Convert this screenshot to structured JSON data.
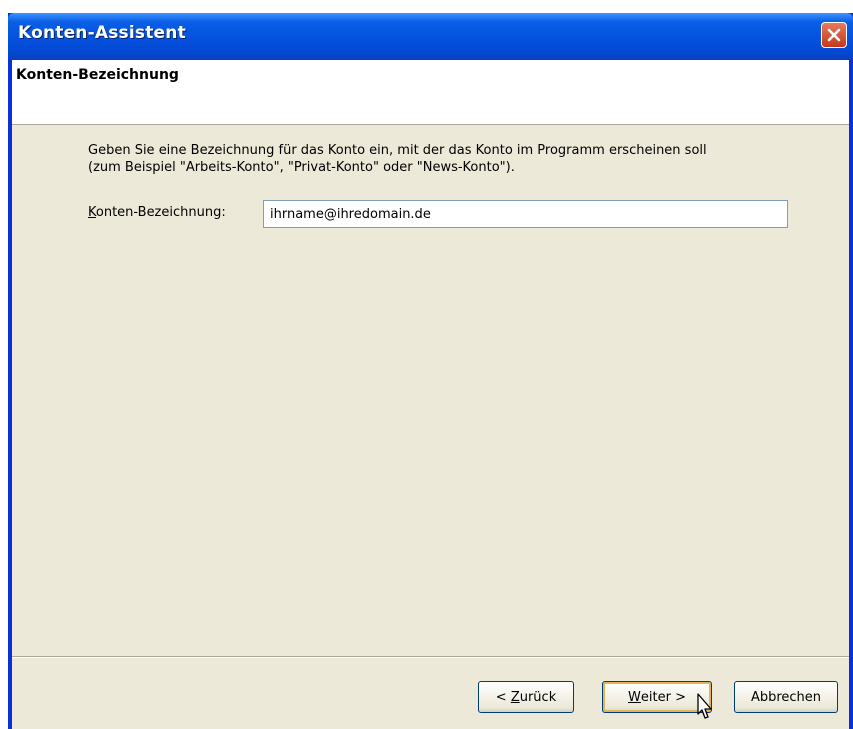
{
  "window": {
    "title": "Konten-Assistent"
  },
  "header": {
    "title": "Konten-Bezeichnung"
  },
  "main": {
    "instruction_line1": "Geben Sie eine Bezeichnung für das Konto ein, mit der das Konto im Programm erscheinen soll",
    "instruction_line2": "(zum Beispiel \"Arbeits-Konto\", \"Privat-Konto\" oder \"News-Konto\").",
    "field_label_accel": "K",
    "field_label_rest": "onten-Bezeichnung:",
    "field_value": "ihrname@ihredomain.de"
  },
  "buttons": {
    "back_prefix": "< ",
    "back_accel": "Z",
    "back_rest": "urück",
    "next_accel": "W",
    "next_rest": "eiter >",
    "cancel_label": "Abbrechen"
  },
  "icons": {
    "close": "close-icon",
    "cursor": "mouse-pointer-icon"
  },
  "colors": {
    "titlebar": "#0453e0",
    "dialog_bg": "#ece9d8",
    "close_button": "#c4381b",
    "default_button_highlight": "#e2b45a"
  }
}
